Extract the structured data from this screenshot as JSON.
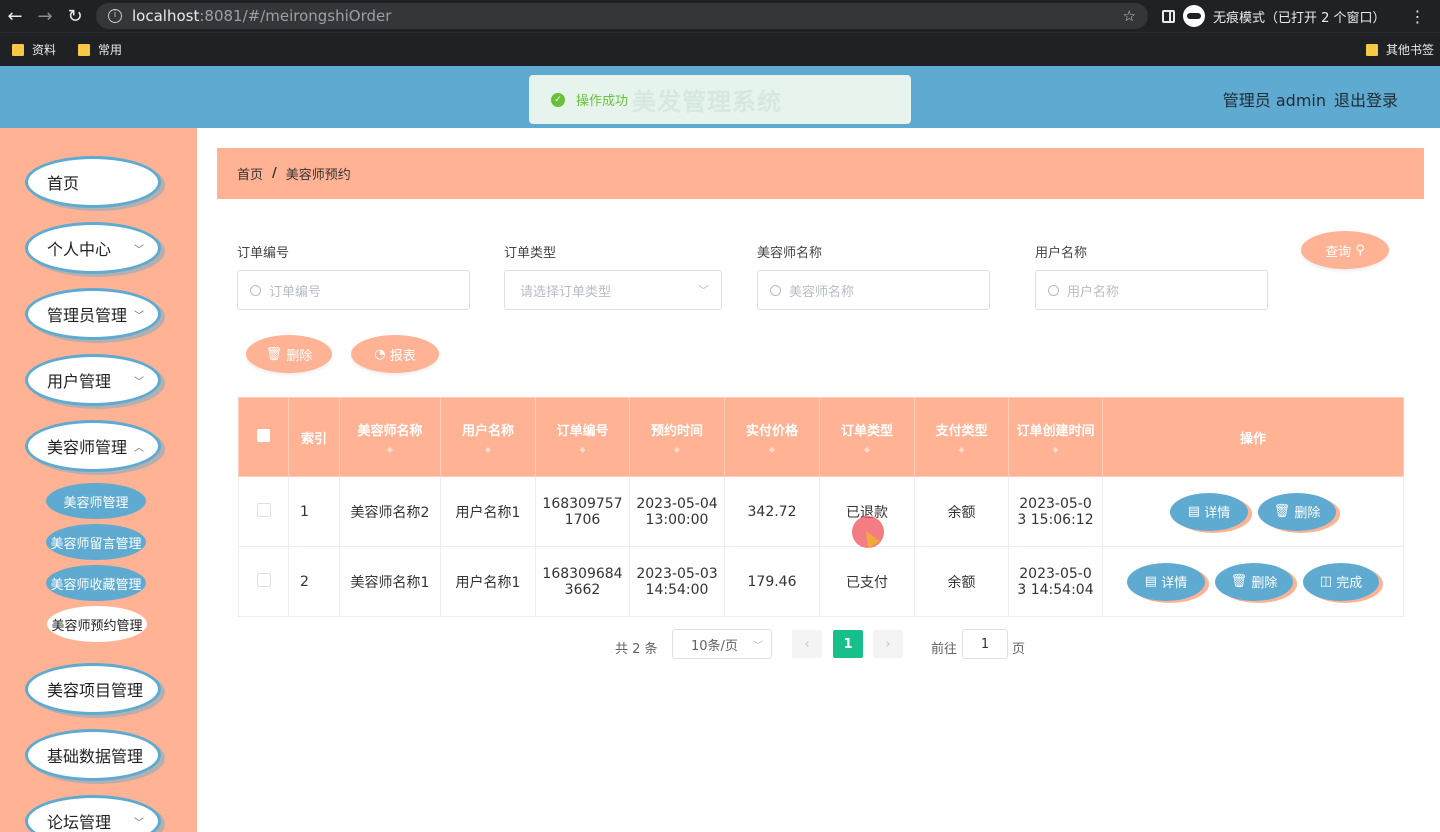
{
  "browser": {
    "url_host": "localhost",
    "url_rest": ":8081/#/meirongshiOrder",
    "incognito_label": "无痕模式（已打开 2 个窗口）",
    "bookmarks": [
      "资料",
      "常用"
    ],
    "other_bookmarks": "其他书签"
  },
  "header": {
    "toast_message": "操作成功",
    "title": "美发管理系统",
    "user": "管理员 admin",
    "logout": "退出登录"
  },
  "sidebar": {
    "items": [
      {
        "label": "首页"
      },
      {
        "label": "个人中心"
      },
      {
        "label": "管理员管理"
      },
      {
        "label": "用户管理"
      },
      {
        "label": "美容师管理"
      },
      {
        "label": "美容项目管理"
      },
      {
        "label": "基础数据管理"
      },
      {
        "label": "论坛管理"
      }
    ],
    "sub_items": [
      {
        "label": "美容师管理"
      },
      {
        "label": "美容师留言管理"
      },
      {
        "label": "美容师收藏管理"
      },
      {
        "label": "美容师预约管理"
      }
    ]
  },
  "breadcrumb": {
    "home": "首页",
    "separator": "/",
    "current": "美容师预约"
  },
  "search": {
    "order_no_label": "订单编号",
    "order_no_placeholder": "订单编号",
    "order_type_label": "订单类型",
    "order_type_placeholder": "请选择订单类型",
    "stylist_label": "美容师名称",
    "stylist_placeholder": "美容师名称",
    "user_label": "用户名称",
    "user_placeholder": "用户名称",
    "query_button": "查询"
  },
  "actions": {
    "delete": "删除",
    "report": "报表"
  },
  "table": {
    "headers": [
      "索引",
      "美容师名称",
      "用户名称",
      "订单编号",
      "预约时间",
      "实付价格",
      "订单类型",
      "支付类型",
      "订单创建时间",
      "操作"
    ],
    "rows": [
      {
        "index": "1",
        "stylist": "美容师名称2",
        "user": "用户名称1",
        "order_no": "1683097571706",
        "appoint_time": "2023-05-04 13:00:00",
        "price": "342.72",
        "order_type": "已退款",
        "pay_type": "余额",
        "created": "2023-05-03 15:06:12",
        "ops": [
          "详情",
          "删除"
        ]
      },
      {
        "index": "2",
        "stylist": "美容师名称1",
        "user": "用户名称1",
        "order_no": "1683096843662",
        "appoint_time": "2023-05-03 14:54:00",
        "price": "179.46",
        "order_type": "已支付",
        "pay_type": "余额",
        "created": "2023-05-03 14:54:04",
        "ops": [
          "详情",
          "删除",
          "完成"
        ]
      }
    ]
  },
  "pagination": {
    "total": "共 2 条",
    "page_size": "10条/页",
    "current_page": "1",
    "goto_label": "前往",
    "goto_value": "1",
    "goto_unit": "页"
  }
}
